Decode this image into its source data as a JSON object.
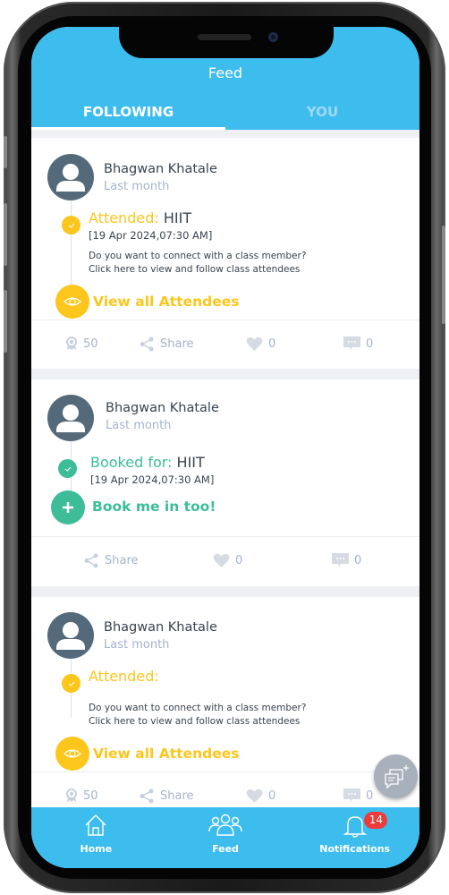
{
  "header": {
    "title": "Feed",
    "tabs": [
      {
        "label": "FOLLOWING",
        "active": true
      },
      {
        "label": "YOU",
        "active": false
      }
    ]
  },
  "posts": [
    {
      "user_name": "Bhagwan Khatale",
      "time": "Last month",
      "status_label": "Attended:",
      "class_name": "HIIT",
      "date": "[19 Apr 2024,07:30 AM]",
      "prompt_line1": "Do you want to connect with a class member?",
      "prompt_line2": "Click here to view and follow class attendees",
      "action_label": "View all Attendees",
      "points": "50",
      "share_label": "Share",
      "likes": "0",
      "comments": "0"
    },
    {
      "user_name": "Bhagwan Khatale",
      "time": "Last month",
      "status_label": "Booked for:",
      "class_name": "HIIT",
      "date": "[19 Apr 2024,07:30 AM]",
      "action_label": "Book me in too!",
      "share_label": "Share",
      "likes": "0",
      "comments": "0"
    },
    {
      "user_name": "Bhagwan Khatale",
      "time": "Last month",
      "status_label": "Attended:",
      "class_name": "",
      "prompt_line1": "Do you want to connect with a class member?",
      "prompt_line2": "Click here to view and follow class attendees",
      "action_label": "View all Attendees",
      "points": "50",
      "share_label": "Share",
      "likes": "0",
      "comments": "0"
    }
  ],
  "bottom_nav": {
    "items": [
      {
        "label": "Home",
        "icon": "home-icon"
      },
      {
        "label": "Feed",
        "icon": "group-icon"
      },
      {
        "label": "Notifications",
        "icon": "bell-icon",
        "badge": "14"
      }
    ]
  },
  "colors": {
    "primary": "#3dbcee",
    "attended": "#fcc61c",
    "booked": "#3dbd97",
    "badge": "#ee3a3a"
  }
}
